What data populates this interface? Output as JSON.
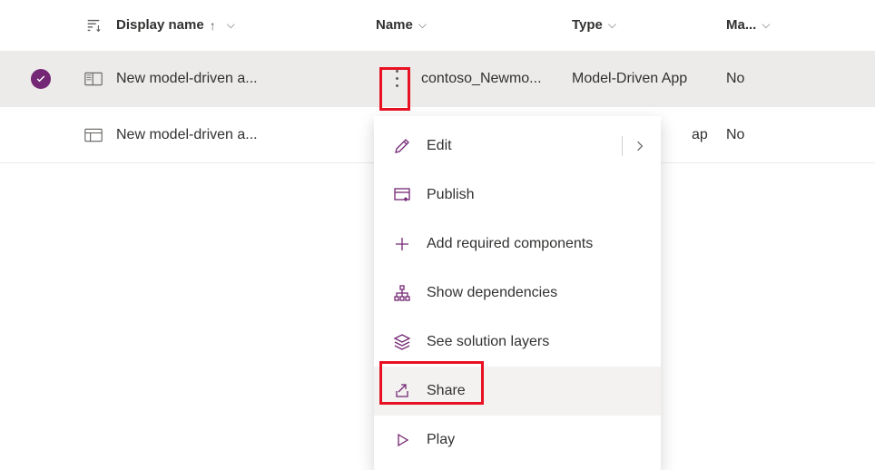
{
  "columns": {
    "display_name": "Display name",
    "name": "Name",
    "type": "Type",
    "managed": "Ma..."
  },
  "rows": [
    {
      "display_name": "New model-driven a...",
      "name": "contoso_Newmo...",
      "type": "Model-Driven App",
      "managed": "No",
      "selected": true
    },
    {
      "display_name": "New model-driven a...",
      "name": "",
      "type": "ap",
      "managed": "No",
      "selected": false
    }
  ],
  "menu": {
    "edit": "Edit",
    "publish": "Publish",
    "add_required": "Add required components",
    "show_deps": "Show dependencies",
    "see_layers": "See solution layers",
    "share": "Share",
    "play": "Play"
  }
}
